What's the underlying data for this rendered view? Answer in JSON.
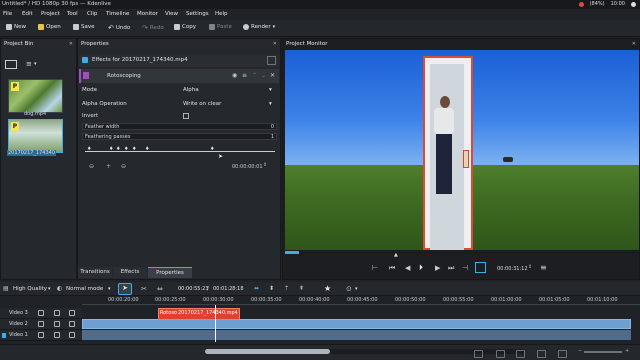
{
  "window": {
    "title": "Untitled* / HD 1080p 30 fps — Kdenlive",
    "battery": "(84%)",
    "clock": "10:00"
  },
  "menu": [
    "File",
    "Edit",
    "Project",
    "Tool",
    "Clip",
    "Timeline",
    "Monitor",
    "View",
    "Settings",
    "Help"
  ],
  "toolbar": {
    "new": "New",
    "open": "Open",
    "save": "Save",
    "undo": "Undo",
    "redo": "Redo",
    "copy": "Copy",
    "paste": "Paste",
    "render": "Render"
  },
  "project_bin": {
    "title": "Project Bin",
    "clips": [
      {
        "label": "dog.mp4",
        "badge": "P"
      },
      {
        "label": "20170217_174340",
        "badge": "P"
      }
    ]
  },
  "properties": {
    "title": "Properties",
    "effects_header": "Effects for 20170217_174340.mp4",
    "effect_name": "Rotoscoping",
    "params": [
      {
        "label": "Mode",
        "value": "Alpha"
      },
      {
        "label": "Alpha Operation",
        "value": "Write on clear"
      },
      {
        "label": "Invert",
        "value": ""
      }
    ],
    "sliders": [
      {
        "label": "Feather width",
        "value": "0"
      },
      {
        "label": "Feathering passes",
        "value": "1"
      }
    ],
    "keyframe_timecode": "00:00:00:01",
    "tabs": [
      "Transitions",
      "Effects",
      "Properties"
    ]
  },
  "monitor": {
    "title": "Project Monitor",
    "timecode": "00:00:31:12"
  },
  "timeline": {
    "quality": "High Quality",
    "mode": "Normal mode",
    "position": "00:00:55:23",
    "duration": "00:01:28:18",
    "ruler": [
      "00:00:20:00",
      "00:00:25:00",
      "00:00:30:00",
      "00:00:35:00",
      "00:00:40:00",
      "00:00:45:00",
      "00:00:50:00",
      "00:00:55:00",
      "00:01:00:00",
      "00:01:05:00",
      "00:01:10:00"
    ],
    "tracks": [
      "Video 3",
      "Video 2",
      "Video 1"
    ],
    "clip_label": "Rotoso",
    "clip_name": "20170217_174340.mp4"
  },
  "colors": {
    "accent": "#3daee9",
    "clip_blue": "#6f9fd0",
    "clip_red": "#e0412e",
    "effect_header": "#31363b"
  },
  "icons": [
    "new-icon",
    "open-icon",
    "save-icon",
    "undo-icon",
    "redo-icon",
    "copy-icon",
    "paste-icon",
    "render-icon"
  ]
}
